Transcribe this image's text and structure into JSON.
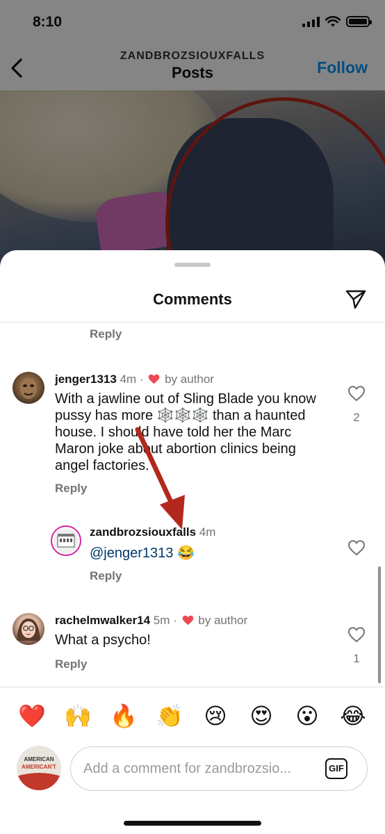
{
  "status_bar": {
    "time": "8:10"
  },
  "nav": {
    "account": "ZANDBROZSIOUXFALLS",
    "title": "Posts",
    "follow_label": "Follow"
  },
  "sheet": {
    "title": "Comments"
  },
  "top_reply_label": "Reply",
  "comments": [
    {
      "username": "jenger1313",
      "time": "4m",
      "sep": "·",
      "by_author": "by author",
      "text": "With a jawline out of Sling Blade you know pussy has more 🕸️🕸️🕸️ than a haunted house. I should have told her the Marc Maron joke about abortion clinics being angel factories.",
      "reply_label": "Reply",
      "likes": "2"
    },
    {
      "username": "zandbrozsiouxfalls",
      "time": "4m",
      "mention": "@jenger1313",
      "emoji": "😂",
      "reply_label": "Reply"
    },
    {
      "username": "rachelmwalker14",
      "time": "5m",
      "sep": "·",
      "by_author": "by author",
      "text": "What a psycho!",
      "reply_label": "Reply",
      "likes": "1"
    }
  ],
  "reactions": [
    "❤️",
    "🙌",
    "🔥",
    "👏",
    "😢",
    "😍",
    "😮",
    "😂"
  ],
  "composer": {
    "placeholder": "Add a comment for zandbrozsio...",
    "gif_label": "GIF"
  },
  "colors": {
    "accent": "#0095f6",
    "heart_red": "#ed4956",
    "mention": "#00376b",
    "arrow": "#b3281c"
  }
}
